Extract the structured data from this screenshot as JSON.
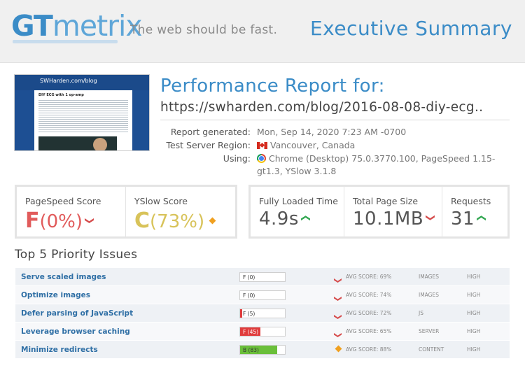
{
  "header": {
    "logo_gt": "GT",
    "logo_metrix": "metrix",
    "tagline": "The web should be fast.",
    "title": "Executive Summary"
  },
  "thumbnail": {
    "site_label": "SWHarden.com/blog",
    "post_title": "DIY ECG with 1 op-amp"
  },
  "report": {
    "title": "Performance Report for:",
    "url": "https://swharden.com/blog/2016-08-08-diy-ecg..",
    "meta": [
      {
        "label": "Report generated:",
        "value": "Mon, Sep 14, 2020 7:23 AM -0700",
        "icon": ""
      },
      {
        "label": "Test Server Region:",
        "value": "Vancouver, Canada",
        "icon": "canada-flag-icon"
      },
      {
        "label": "Using:",
        "value_line1": "Chrome (Desktop) 75.0.3770.100, PageSpeed 1.15-",
        "value_line2": "gt1.3, YSlow 3.1.8",
        "icon": "chrome-icon"
      }
    ]
  },
  "scores": {
    "pagespeed": {
      "label": "PageSpeed Score",
      "grade": "F",
      "percent": "(0%)",
      "trend": "down"
    },
    "yslow": {
      "label": "YSlow Score",
      "grade": "C",
      "percent": "(73%)",
      "trend": "neutral"
    }
  },
  "metrics": {
    "fully_loaded": {
      "label": "Fully Loaded Time",
      "value": "4.9s",
      "trend": "up"
    },
    "page_size": {
      "label": "Total Page Size",
      "value": "10.1MB",
      "trend": "down"
    },
    "requests": {
      "label": "Requests",
      "value": "31",
      "trend": "up"
    }
  },
  "issues": {
    "title": "Top 5 Priority Issues",
    "rows": [
      {
        "name": "Serve scaled images",
        "grade_text": "F (0)",
        "score": 0,
        "fill_color": "#e03c3c",
        "avg_icon": "chevron-down",
        "avg": "AVG SCORE: 69%",
        "category": "IMAGES",
        "priority": "HIGH"
      },
      {
        "name": "Optimize images",
        "grade_text": "F (0)",
        "score": 0,
        "fill_color": "#e03c3c",
        "avg_icon": "chevron-down",
        "avg": "AVG SCORE: 74%",
        "category": "IMAGES",
        "priority": "HIGH"
      },
      {
        "name": "Defer parsing of JavaScript",
        "grade_text": "F (5)",
        "score": 5,
        "fill_color": "#e03c3c",
        "avg_icon": "chevron-down",
        "avg": "AVG SCORE: 72%",
        "category": "JS",
        "priority": "HIGH"
      },
      {
        "name": "Leverage browser caching",
        "grade_text": "F (45)",
        "score": 45,
        "fill_color": "#e03c3c",
        "avg_icon": "chevron-down",
        "avg": "AVG SCORE: 65%",
        "category": "SERVER",
        "priority": "HIGH"
      },
      {
        "name": "Minimize redirects",
        "grade_text": "B (83)",
        "score": 83,
        "fill_color": "#6abf3a",
        "avg_icon": "diamond",
        "avg": "AVG SCORE: 88%",
        "category": "CONTENT",
        "priority": "HIGH"
      }
    ]
  }
}
